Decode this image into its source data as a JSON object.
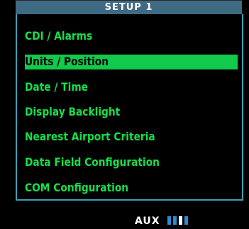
{
  "screen": {
    "title": "SETUP 1"
  },
  "menu": {
    "items": [
      {
        "label": "CDI / Alarms",
        "selected": false
      },
      {
        "label": "Units / Position",
        "selected": true
      },
      {
        "label": "Date / Time",
        "selected": false
      },
      {
        "label": "Display Backlight",
        "selected": false
      },
      {
        "label": "Nearest Airport Criteria",
        "selected": false
      },
      {
        "label": "Data Field Configuration",
        "selected": false
      },
      {
        "label": "COM Configuration",
        "selected": false
      }
    ]
  },
  "status_bar": {
    "page_group": "AUX",
    "page_count": 4,
    "current_page": 3
  },
  "colors": {
    "menu_text": "#14e04a",
    "highlight": "#11c94a",
    "title_bar": "#3f6a83",
    "border": "#3aa0b8",
    "page_indicator": "#2e8bd0"
  }
}
